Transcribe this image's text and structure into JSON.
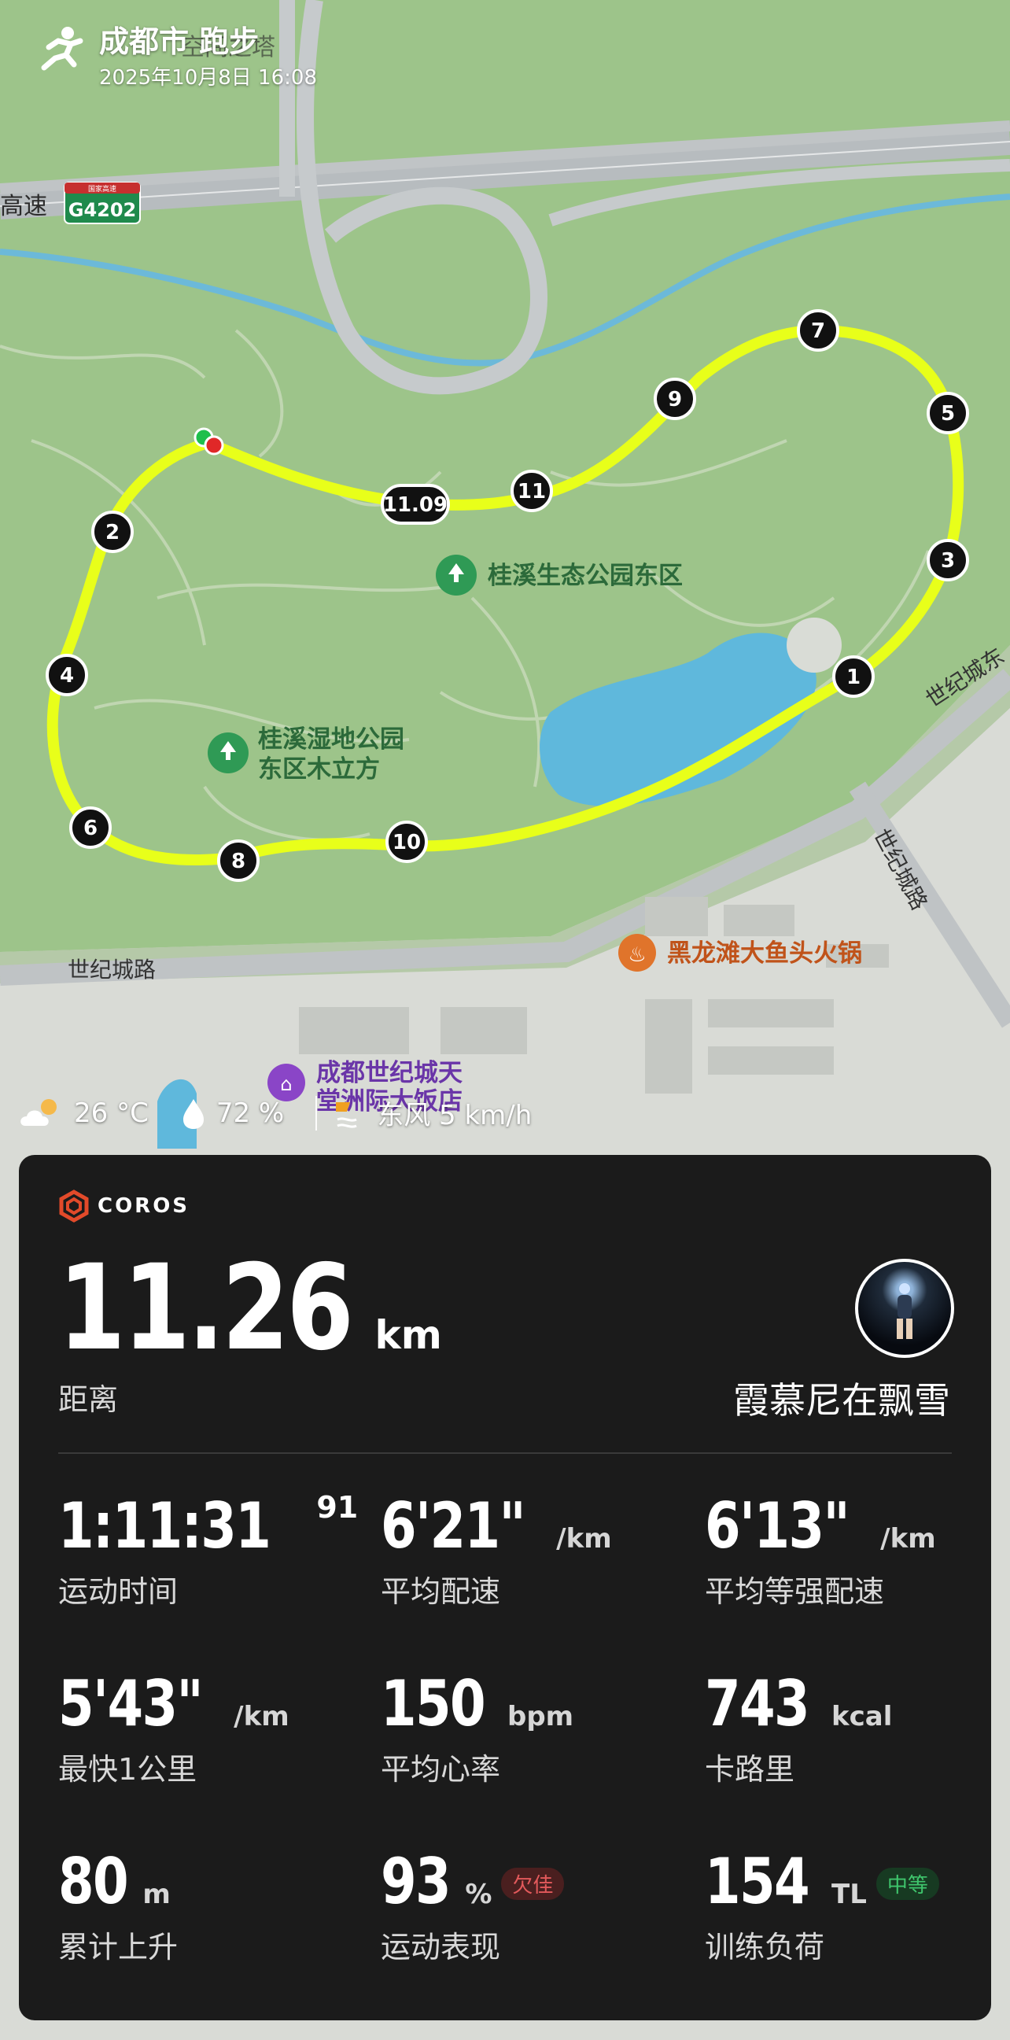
{
  "header": {
    "title": "成都市 跑步",
    "datetime": "2025年10月8日 16:08"
  },
  "map": {
    "road_labels": {
      "expressway": "高速",
      "shield": "G4202",
      "shield_top": "国家高速",
      "century_road_w": "世纪城路",
      "century_road_e": "世纪城路",
      "century_road_ne": "世纪城东",
      "top_partial": "空间之塔"
    },
    "pois": {
      "park_east": "桂溪生态公园东区",
      "wetland_line1": "桂溪湿地公园",
      "wetland_line2": "东区木立方",
      "hotpot": "黑龙滩大鱼头火锅",
      "hotel_line1": "成都世纪城天",
      "hotel_line2": "堂洲际大饭店"
    },
    "km_markers": [
      "1",
      "2",
      "3",
      "4",
      "5",
      "6",
      "7",
      "8",
      "9",
      "10",
      "11",
      "11.09"
    ],
    "route_color": "#e8ff1a"
  },
  "weather": {
    "temperature": "26 °C",
    "humidity": "72 %",
    "wind": "东风 5 km/h"
  },
  "card": {
    "brand": "COROS",
    "distance": {
      "value": "11.26",
      "unit": "km",
      "label": "距离"
    },
    "username": "霞慕尼在飘雪",
    "stats": [
      {
        "value": "1:11:31",
        "sup": "91",
        "unit": "",
        "label": "运动时间"
      },
      {
        "value": "6'21\"",
        "unit": "/km",
        "label": "平均配速"
      },
      {
        "value": "6'13\"",
        "unit": "/km",
        "label": "平均等强配速"
      },
      {
        "value": "5'43\"",
        "unit": "/km",
        "label": "最快1公里"
      },
      {
        "value": "150",
        "unit": "bpm",
        "label": "平均心率"
      },
      {
        "value": "743",
        "unit": "kcal",
        "label": "卡路里"
      },
      {
        "value": "80",
        "unit": "m",
        "label": "累计上升"
      },
      {
        "value": "93",
        "unit": "%",
        "label": "运动表现",
        "badge": "欠佳"
      },
      {
        "value": "154",
        "unit": "TL",
        "label": "训练负荷",
        "badge": "中等"
      }
    ]
  }
}
